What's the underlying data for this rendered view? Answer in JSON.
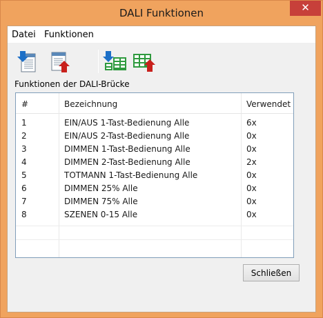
{
  "window": {
    "title": "DALI Funktionen",
    "close_glyph": "✕"
  },
  "menu": {
    "items": [
      "Datei",
      "Funktionen"
    ]
  },
  "toolbar": {
    "buttons": [
      {
        "icon": "import-icon"
      },
      {
        "icon": "export-icon"
      },
      {
        "icon": "import-table-icon"
      },
      {
        "icon": "export-table-icon"
      }
    ]
  },
  "group": {
    "label": "Funktionen der DALI-Brücke"
  },
  "table": {
    "headers": [
      "#",
      "Bezeichnung",
      "Verwendet"
    ],
    "rows": [
      [
        "1",
        "EIN/AUS 1-Tast-Bedienung Alle",
        "6x"
      ],
      [
        "2",
        "EIN/AUS 2-Tast-Bedienung Alle",
        "0x"
      ],
      [
        "3",
        "DIMMEN 1-Tast-Bedienung Alle",
        "0x"
      ],
      [
        "4",
        "DIMMEN 2-Tast-Bedienung Alle",
        "2x"
      ],
      [
        "5",
        "TOTMANN 1-Tast-Bedienung Alle",
        "0x"
      ],
      [
        "6",
        "DIMMEN 25% Alle",
        "0x"
      ],
      [
        "7",
        "DIMMEN 75% Alle",
        "0x"
      ],
      [
        "8",
        "SZENEN 0-15 Alle",
        "0x"
      ]
    ]
  },
  "footer": {
    "close_label": "Schließen"
  },
  "colors": {
    "titlebar": "#f0a35e",
    "close": "#c7403a",
    "arrow_blue": "#1c6fc7",
    "arrow_red": "#c8201c",
    "table_green": "#2e9a3e"
  }
}
